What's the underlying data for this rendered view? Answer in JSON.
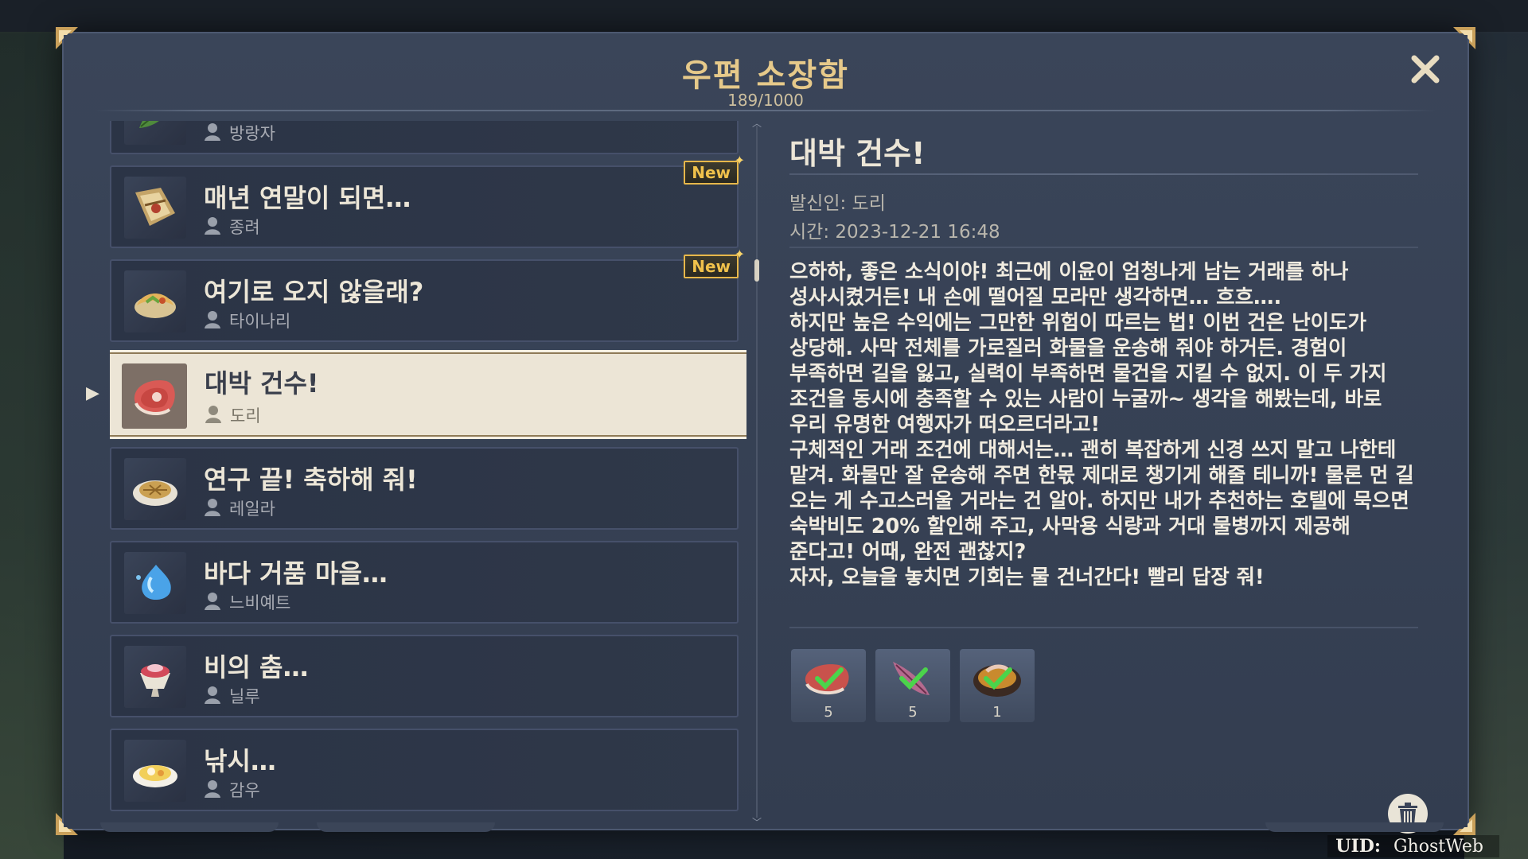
{
  "window": {
    "title": "우편 소장함",
    "count": "189/1000",
    "close_label": "✕",
    "uid_label": "UID:",
    "uid_value": "GhostWeb"
  },
  "mails": [
    {
      "subject": "",
      "sender": "방랑자",
      "icon": "leaf-icon",
      "is_new": false,
      "selected": false
    },
    {
      "subject": "매년 연말이 되면…",
      "sender": "종려",
      "icon": "scroll-bundle-icon",
      "is_new": true,
      "selected": false
    },
    {
      "subject": "여기로 오지 않을래?",
      "sender": "타이나리",
      "icon": "wrap-food-icon",
      "is_new": true,
      "selected": false
    },
    {
      "subject": "대박 건수!",
      "sender": "도리",
      "icon": "raw-meat-icon",
      "is_new": false,
      "selected": true
    },
    {
      "subject": "연구 끝! 축하해 줘!",
      "sender": "레일라",
      "icon": "pie-dish-icon",
      "is_new": false,
      "selected": false
    },
    {
      "subject": "바다 거품 마을…",
      "sender": "느비예트",
      "icon": "water-drop-icon",
      "is_new": false,
      "selected": false
    },
    {
      "subject": "비의 춤…",
      "sender": "닐루",
      "icon": "dessert-cup-icon",
      "is_new": false,
      "selected": false
    },
    {
      "subject": "낚시…",
      "sender": "감우",
      "icon": "rice-dish-icon",
      "is_new": false,
      "selected": false
    }
  ],
  "new_badge": "New",
  "detail": {
    "title": "대박 건수!",
    "sender_line": "발신인: 도리",
    "time_line": "시간: 2023-12-21 16:48",
    "body": "으하하, 좋은 소식이야! 최근에 이윤이 엄청나게 남는 거래를 하나\n성사시켰거든! 내 손에 떨어질 모라만 생각하면… 흐흐….\n하지만 높은 수익에는 그만한 위험이 따르는 법! 이번 건은 난이도가\n상당해. 사막 전체를 가로질러 화물을 운송해 줘야 하거든. 경험이\n부족하면 길을 잃고, 실력이 부족하면 물건을 지킬 수 없지. 이 두 가지\n조건을 동시에 충족할 수 있는 사람이 누굴까~ 생각을 해봤는데, 바로\n우리 유명한 여행자가 떠오르더라고!\n구체적인 거래 조건에 대해서는… 괜히 복잡하게 신경 쓰지 말고 나한테\n맡겨. 화물만 잘 운송해 주면 한몫 제대로 챙기게 해줄 테니까! 물론 먼 길\n오는 게 수고스러울 거라는 건 알아. 하지만 내가 추천하는 호텔에 묵으면\n숙박비도 20% 할인해 주고, 사막용 식량과 거대 물병까지 제공해\n준다고! 어때, 완전 괜찮지?\n자자, 오늘을 놓치면 기회는 물 건너간다! 빨리 답장 줘!",
    "attachments": [
      {
        "icon": "raw-meat-icon",
        "qty": "5",
        "claimed": true
      },
      {
        "icon": "feather-icon",
        "qty": "5",
        "claimed": true
      },
      {
        "icon": "soup-bowl-icon",
        "qty": "1",
        "claimed": true
      }
    ]
  },
  "colors": {
    "panel": "#353f52",
    "accent_gold": "#e6c98a",
    "new_badge": "#f0c14b",
    "selected_bg": "#ece5d6",
    "check_green": "#4bd44b"
  }
}
